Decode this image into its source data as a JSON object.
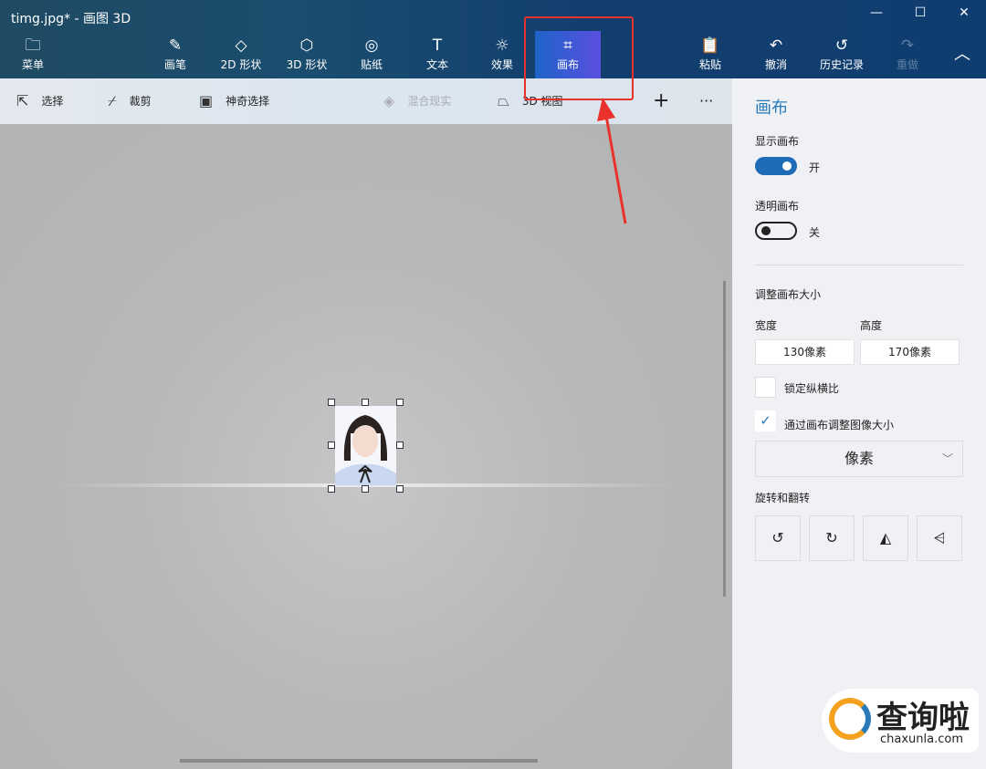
{
  "window": {
    "title": "timg.jpg* - 画图 3D",
    "minimize": "—",
    "maximize": "☐",
    "close": "✕"
  },
  "toolbar": {
    "items": [
      {
        "label": "菜单",
        "icon": "folder-icon"
      },
      {
        "label": "画笔",
        "icon": "brush-icon"
      },
      {
        "label": "2D 形状",
        "icon": "2d-shapes-icon"
      },
      {
        "label": "3D 形状",
        "icon": "3d-shapes-icon"
      },
      {
        "label": "贴纸",
        "icon": "sticker-icon"
      },
      {
        "label": "文本",
        "icon": "text-icon"
      },
      {
        "label": "效果",
        "icon": "effects-icon"
      },
      {
        "label": "画布",
        "icon": "canvas-icon"
      },
      {
        "label": "粘贴",
        "icon": "paste-icon"
      },
      {
        "label": "撤消",
        "icon": "undo-icon"
      },
      {
        "label": "历史记录",
        "icon": "history-icon"
      },
      {
        "label": "重做",
        "icon": "redo-icon"
      }
    ],
    "active": "画布"
  },
  "subtoolbar": {
    "select": "选择",
    "crop": "裁剪",
    "magic_select": "神奇选择",
    "mixed_reality": "混合现实",
    "view_3d": "3D 视图"
  },
  "panel": {
    "title": "画布",
    "show_canvas": {
      "label": "显示画布",
      "state": "开",
      "on": true
    },
    "transparent_canvas": {
      "label": "透明画布",
      "state": "关",
      "on": false
    },
    "resize_title": "调整画布大小",
    "width_label": "宽度",
    "height_label": "高度",
    "width_value": "130像素",
    "height_value": "170像素",
    "lock_aspect": {
      "label": "锁定纵横比",
      "checked": false
    },
    "resize_image": {
      "label": "通过画布调整图像大小",
      "checked": true
    },
    "unit": "像素",
    "rotate_title": "旋转和翻转"
  },
  "watermark": {
    "text": "查询啦",
    "url": "chaxunla.com"
  },
  "colors": {
    "accent": "#2a7ab8",
    "annotation": "#e8322b"
  }
}
